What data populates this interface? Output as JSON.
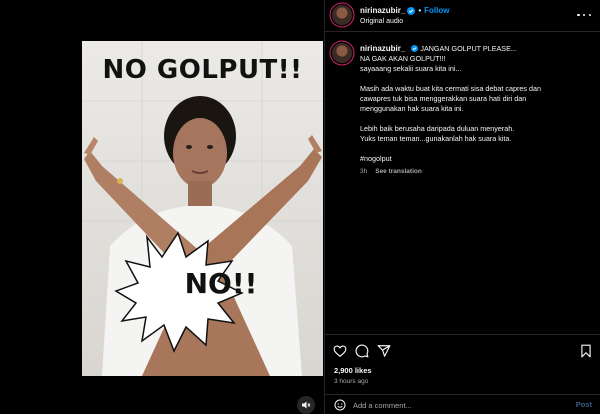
{
  "post": {
    "username": "nirinazubir_",
    "verified": true,
    "separator": "•",
    "follow_label": "Follow",
    "audio_label": "Original audio",
    "more_icon": "more-horizontal-icon"
  },
  "media": {
    "headline": "NO GOLPUT!!",
    "burst_text": "NO!!",
    "mute_icon": "speaker-muted-icon"
  },
  "caption": {
    "username": "nirinazubir_",
    "lines": [
      "JANGAN GOLPUT PLEASE...",
      "NA GAK AKAN GOLPUT!!!",
      "sayaaang sekalii suara kita ini..."
    ],
    "paragraph2": [
      "Masih ada waktu buat kita cermati sisa debat capres dan",
      "cawapres tuk bisa menggerakkan suara hati diri dan",
      "menggunakan hak suara kita ini."
    ],
    "paragraph3": [
      "Lebih baik berusaha daripada duluan menyerah.",
      "Yuks teman teman...gunakanlah hak suara kita."
    ],
    "hashtag": "#nogolput",
    "age": "3h",
    "see_translation": "See translation"
  },
  "actions": {
    "icons": [
      "heart-icon",
      "comment-icon",
      "share-icon",
      "bookmark-icon"
    ],
    "likes": "2,900 likes",
    "time_ago": "3 hours ago"
  },
  "comment": {
    "placeholder": "Add a comment...",
    "post_label": "Post"
  },
  "colors": {
    "accent": "#0095f6",
    "background": "#000000",
    "text": "#f5f5f5",
    "muted": "#a8a8a8",
    "divider": "#262626",
    "story_ring": "#d6246e"
  }
}
